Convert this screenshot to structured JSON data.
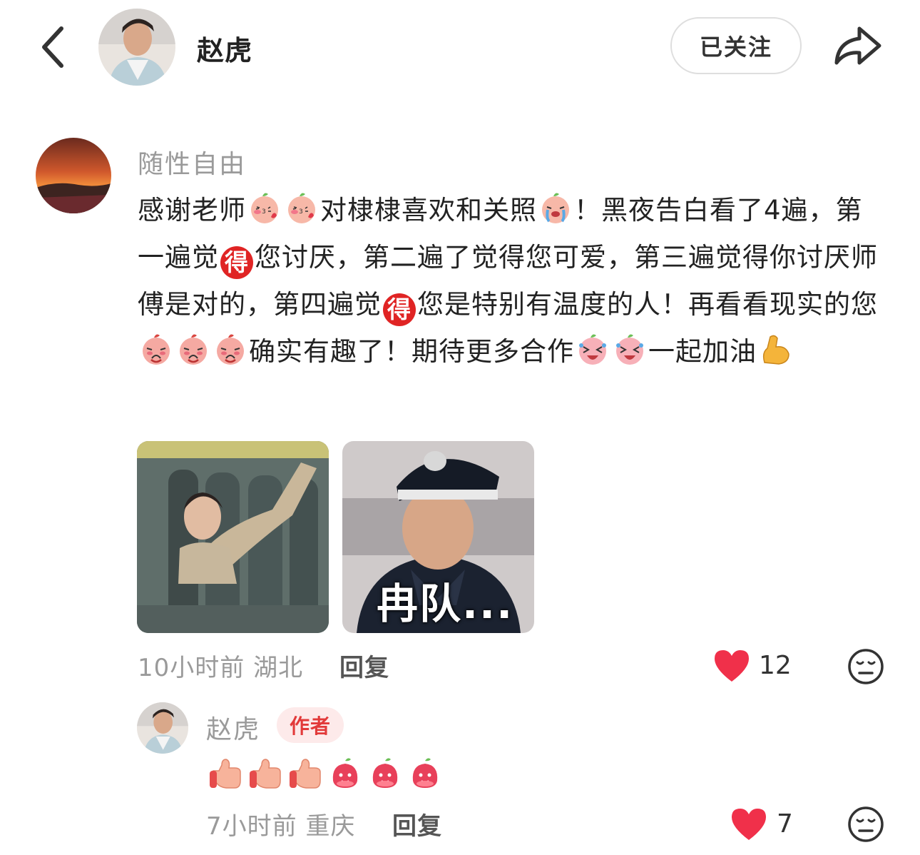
{
  "header": {
    "title": "赵虎",
    "follow_label": "已关注"
  },
  "comment": {
    "author": "随性自由",
    "segments": [
      {
        "t": "text",
        "v": "感谢老师"
      },
      {
        "t": "emoji",
        "v": "kiss"
      },
      {
        "t": "emoji",
        "v": "kiss"
      },
      {
        "t": "text",
        "v": "对棣棣喜欢和关照"
      },
      {
        "t": "emoji",
        "v": "cry"
      },
      {
        "t": "text",
        "v": "！黑夜告白看了4遍，第一遍觉"
      },
      {
        "t": "de",
        "v": "得"
      },
      {
        "t": "text",
        "v": "您讨厌，第二遍了觉得您可爱，第三遍觉得你讨厌师傅是对的，第四遍觉"
      },
      {
        "t": "de",
        "v": "得"
      },
      {
        "t": "text",
        "v": "您是特别有温度的人！再看看现实的您"
      },
      {
        "t": "emoji",
        "v": "pout"
      },
      {
        "t": "emoji",
        "v": "pout"
      },
      {
        "t": "emoji",
        "v": "pout"
      },
      {
        "t": "text",
        "v": "确实有趣了！期待更多合作"
      },
      {
        "t": "emoji",
        "v": "laugh"
      },
      {
        "t": "emoji",
        "v": "laugh"
      },
      {
        "t": "text",
        "v": "一起加油"
      },
      {
        "t": "emoji",
        "v": "muscle"
      }
    ],
    "photo2_caption": "冉队...",
    "time": "10小时前",
    "location": "湖北",
    "reply_label": "回复",
    "likes": "12"
  },
  "reply": {
    "author": "赵虎",
    "badge": "作者",
    "emojis": [
      "thumb",
      "thumb",
      "thumb",
      "peach",
      "peach",
      "peach"
    ],
    "time": "7小时前",
    "location": "重庆",
    "reply_label": "回复",
    "likes": "7"
  },
  "colors": {
    "heart": "#f0304a",
    "badge_text": "#e23a3a",
    "badge_bg": "#fdeaea",
    "muted": "#9a9a9a"
  },
  "icons": [
    "back-arrow-icon",
    "share-icon",
    "heart-icon",
    "dislike-face-icon"
  ]
}
